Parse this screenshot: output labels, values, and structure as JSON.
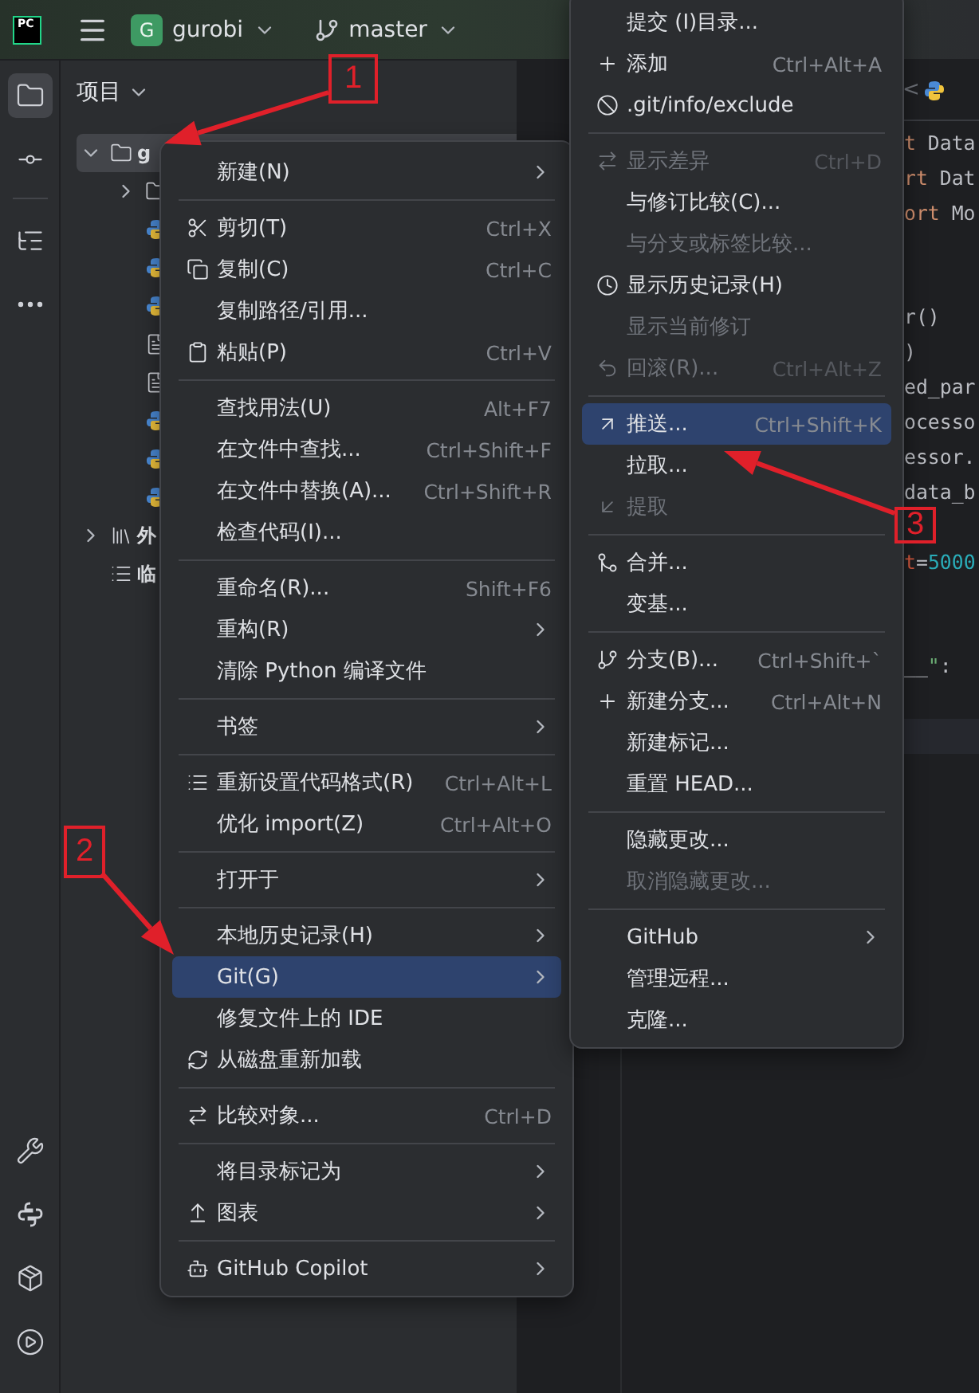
{
  "top_bar": {
    "logo": "PC",
    "project": {
      "badge": "G",
      "name": "gurobi"
    },
    "branch": "master"
  },
  "tool_strip": [
    {
      "selected": true
    },
    {
      "selected": false
    },
    {
      "selected": false
    },
    {
      "selected": false
    }
  ],
  "tool_strip_bottom": [
    {
      "selected": false
    },
    {
      "selected": false
    },
    {
      "selected": false
    },
    {
      "selected": false
    }
  ],
  "project_panel": {
    "title": "项目",
    "tree": [
      {
        "kind": "folder",
        "label": "g",
        "expanded": true,
        "selected": true,
        "children": [
          {
            "kind": "folder",
            "expanded": false,
            "selected": false
          },
          {
            "kind": "python",
            "selected": false
          },
          {
            "kind": "python",
            "selected": false
          },
          {
            "kind": "python",
            "selected": false
          },
          {
            "kind": "text",
            "selected": false
          },
          {
            "kind": "text",
            "selected": false
          },
          {
            "kind": "python",
            "selected": false
          },
          {
            "kind": "python",
            "selected": false
          },
          {
            "kind": "python",
            "selected": false
          }
        ]
      },
      {
        "kind": "library",
        "label": "外",
        "expanded": false,
        "selected": false
      },
      {
        "kind": "scratch",
        "label": "临",
        "selected": false
      }
    ]
  },
  "editor": {
    "tab_scroll": "<",
    "lines": [
      {
        "current": false,
        "parts": [
          {
            "kind": "keyword",
            "text": "t"
          },
          {
            "kind": "plain",
            "text": " Data"
          }
        ]
      },
      {
        "current": false,
        "parts": [
          {
            "kind": "keyword",
            "text": "rt"
          },
          {
            "kind": "plain",
            "text": " Dat"
          }
        ]
      },
      {
        "current": false,
        "parts": [
          {
            "kind": "keyword",
            "text": "ort"
          },
          {
            "kind": "plain",
            "text": " Mo"
          }
        ]
      },
      {
        "current": false
      },
      {
        "current": false
      },
      {
        "current": false,
        "parts": [
          {
            "kind": "plain",
            "text": "r()"
          }
        ]
      },
      {
        "current": false,
        "parts": [
          {
            "kind": "plain",
            "text": ")"
          }
        ]
      },
      {
        "current": false,
        "parts": [
          {
            "kind": "plain",
            "text": "ed_par"
          }
        ]
      },
      {
        "current": false,
        "parts": [
          {
            "kind": "plain",
            "text": "ocesso"
          }
        ]
      },
      {
        "current": false,
        "parts": [
          {
            "kind": "plain",
            "text": "essor."
          }
        ]
      },
      {
        "current": false,
        "parts": [
          {
            "kind": "plain",
            "text": "data_b"
          }
        ]
      },
      {
        "current": false
      },
      {
        "current": false,
        "parts": [
          {
            "kind": "param",
            "text": "t"
          },
          {
            "kind": "plain",
            "text": "="
          },
          {
            "kind": "number",
            "text": "5000"
          }
        ]
      },
      {
        "current": false
      },
      {
        "current": false
      },
      {
        "current": false,
        "parts": [
          {
            "kind": "plain",
            "text": "__"
          },
          {
            "kind": "string",
            "text": "\""
          },
          {
            "kind": "plain",
            "text": ":"
          }
        ]
      },
      {
        "current": false
      },
      {
        "current": true
      }
    ]
  },
  "context_menu": {
    "items": [
      {
        "kind": "item",
        "label": "新建(N)",
        "submenu": true,
        "disabled": false,
        "selected": false
      },
      {
        "kind": "separator"
      },
      {
        "kind": "item",
        "label": "剪切(T)",
        "shortcut": "Ctrl+X",
        "disabled": false,
        "selected": false
      },
      {
        "kind": "item",
        "label": "复制(C)",
        "shortcut": "Ctrl+C",
        "disabled": false,
        "selected": false
      },
      {
        "kind": "item",
        "label": "复制路径/引用...",
        "disabled": false,
        "selected": false
      },
      {
        "kind": "item",
        "label": "粘贴(P)",
        "shortcut": "Ctrl+V",
        "disabled": false,
        "selected": false
      },
      {
        "kind": "separator"
      },
      {
        "kind": "item",
        "label": "查找用法(U)",
        "shortcut": "Alt+F7",
        "disabled": false,
        "selected": false
      },
      {
        "kind": "item",
        "label": "在文件中查找...",
        "shortcut": "Ctrl+Shift+F",
        "disabled": false,
        "selected": false
      },
      {
        "kind": "item",
        "label": "在文件中替换(A)...",
        "shortcut": "Ctrl+Shift+R",
        "disabled": false,
        "selected": false
      },
      {
        "kind": "item",
        "label": "检查代码(I)...",
        "disabled": false,
        "selected": false
      },
      {
        "kind": "separator"
      },
      {
        "kind": "item",
        "label": "重命名(R)...",
        "shortcut": "Shift+F6",
        "disabled": false,
        "selected": false
      },
      {
        "kind": "item",
        "label": "重构(R)",
        "submenu": true,
        "disabled": false,
        "selected": false
      },
      {
        "kind": "item",
        "label": "清除 Python 编译文件",
        "disabled": false,
        "selected": false
      },
      {
        "kind": "separator"
      },
      {
        "kind": "item",
        "label": "书签",
        "submenu": true,
        "disabled": false,
        "selected": false
      },
      {
        "kind": "separator"
      },
      {
        "kind": "item",
        "label": "重新设置代码格式(R)",
        "shortcut": "Ctrl+Alt+L",
        "disabled": false,
        "selected": false
      },
      {
        "kind": "item",
        "label": "优化 import(Z)",
        "shortcut": "Ctrl+Alt+O",
        "disabled": false,
        "selected": false
      },
      {
        "kind": "separator"
      },
      {
        "kind": "item",
        "label": "打开于",
        "submenu": true,
        "disabled": false,
        "selected": false
      },
      {
        "kind": "separator"
      },
      {
        "kind": "item",
        "label": "本地历史记录(H)",
        "submenu": true,
        "disabled": false,
        "selected": false
      },
      {
        "kind": "item",
        "label": "Git(G)",
        "submenu": true,
        "disabled": false,
        "selected": true
      },
      {
        "kind": "item",
        "label": "修复文件上的 IDE",
        "disabled": false,
        "selected": false
      },
      {
        "kind": "item",
        "label": "从磁盘重新加载",
        "disabled": false,
        "selected": false
      },
      {
        "kind": "separator"
      },
      {
        "kind": "item",
        "label": "比较对象...",
        "shortcut": "Ctrl+D",
        "disabled": false,
        "selected": false
      },
      {
        "kind": "separator"
      },
      {
        "kind": "item",
        "label": "将目录标记为",
        "submenu": true,
        "disabled": false,
        "selected": false
      },
      {
        "kind": "item",
        "label": "图表",
        "submenu": true,
        "disabled": false,
        "selected": false
      },
      {
        "kind": "separator"
      },
      {
        "kind": "item",
        "label": "GitHub Copilot",
        "submenu": true,
        "disabled": false,
        "selected": false
      }
    ]
  },
  "git_submenu": {
    "items": [
      {
        "kind": "item",
        "label": "提交 (I)目录...",
        "disabled": false,
        "selected": false
      },
      {
        "kind": "item",
        "label": "添加",
        "shortcut": "Ctrl+Alt+A",
        "disabled": false,
        "selected": false
      },
      {
        "kind": "item",
        "label": ".git/info/exclude",
        "disabled": false,
        "selected": false
      },
      {
        "kind": "separator"
      },
      {
        "kind": "item",
        "label": "显示差异",
        "shortcut": "Ctrl+D",
        "disabled": true,
        "selected": false
      },
      {
        "kind": "item",
        "label": "与修订比较(C)...",
        "disabled": false,
        "selected": false
      },
      {
        "kind": "item",
        "label": "与分支或标签比较...",
        "disabled": true,
        "selected": false
      },
      {
        "kind": "item",
        "label": "显示历史记录(H)",
        "disabled": false,
        "selected": false
      },
      {
        "kind": "item",
        "label": "显示当前修订",
        "disabled": true,
        "selected": false
      },
      {
        "kind": "item",
        "label": "回滚(R)...",
        "shortcut": "Ctrl+Alt+Z",
        "disabled": true,
        "selected": false
      },
      {
        "kind": "separator"
      },
      {
        "kind": "item",
        "label": "推送...",
        "shortcut": "Ctrl+Shift+K",
        "disabled": false,
        "selected": true
      },
      {
        "kind": "item",
        "label": "拉取...",
        "disabled": false,
        "selected": false
      },
      {
        "kind": "item",
        "label": "提取",
        "disabled": true,
        "selected": false
      },
      {
        "kind": "separator"
      },
      {
        "kind": "item",
        "label": "合并...",
        "disabled": false,
        "selected": false
      },
      {
        "kind": "item",
        "label": "变基...",
        "disabled": false,
        "selected": false
      },
      {
        "kind": "separator"
      },
      {
        "kind": "item",
        "label": "分支(B)...",
        "shortcut": "Ctrl+Shift+`",
        "disabled": false,
        "selected": false
      },
      {
        "kind": "item",
        "label": "新建分支...",
        "shortcut": "Ctrl+Alt+N",
        "disabled": false,
        "selected": false
      },
      {
        "kind": "item",
        "label": "新建标记...",
        "disabled": false,
        "selected": false
      },
      {
        "kind": "item",
        "label": "重置 HEAD...",
        "disabled": false,
        "selected": false
      },
      {
        "kind": "separator"
      },
      {
        "kind": "item",
        "label": "隐藏更改...",
        "disabled": false,
        "selected": false
      },
      {
        "kind": "item",
        "label": "取消隐藏更改...",
        "disabled": true,
        "selected": false
      },
      {
        "kind": "separator"
      },
      {
        "kind": "item",
        "label": "GitHub",
        "submenu": true,
        "disabled": false,
        "selected": false
      },
      {
        "kind": "item",
        "label": "管理远程...",
        "disabled": false,
        "selected": false
      },
      {
        "kind": "item",
        "label": "克隆...",
        "disabled": false,
        "selected": false
      }
    ]
  },
  "annotations": [
    {
      "label": "1"
    },
    {
      "label": "2"
    },
    {
      "label": "3"
    }
  ]
}
